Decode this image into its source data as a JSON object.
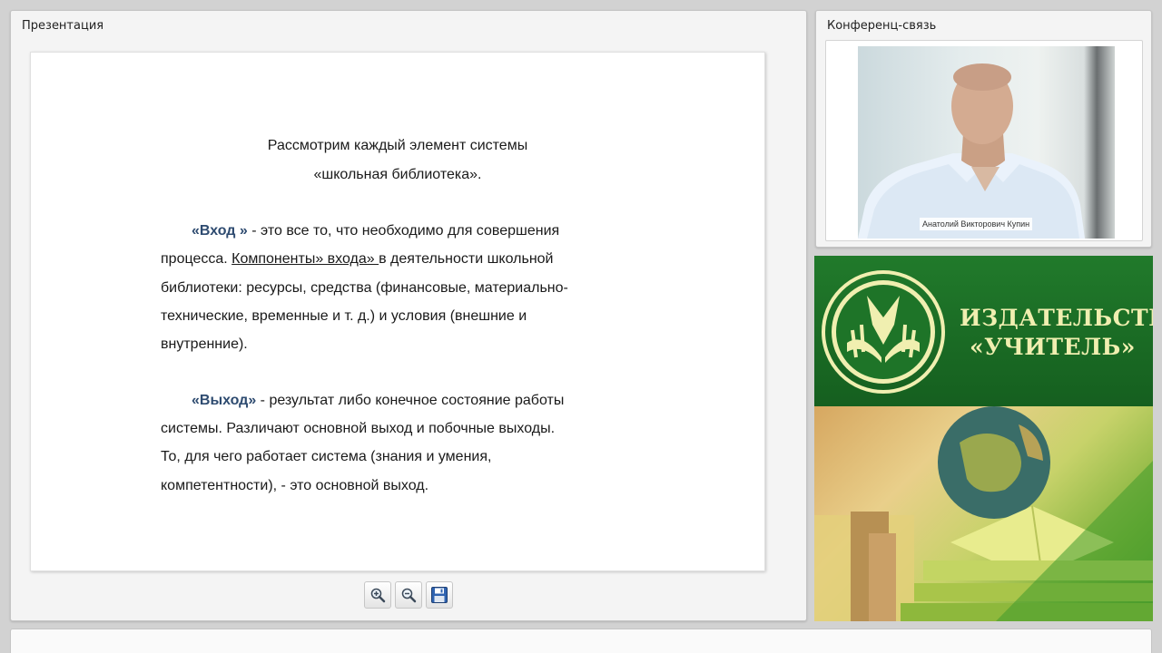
{
  "presentation_panel": {
    "title": "Презентация"
  },
  "slide": {
    "heading_line1": "Рассмотрим каждый элемент системы",
    "heading_line2": "«школьная библиотека».",
    "input_term": "«Вход »",
    "input_text1": " - это все то, что необходимо для совершения",
    "input_text2_a": "процесса.  ",
    "input_text2_link": "Компоненты» входа» ",
    "input_text2_b": "в деятельности школьной",
    "input_text3": "библиотеки:  ресурсы, средства  (финансовые, материально-",
    "input_text4": "технические, временные и т. д.) и условия (внешние и",
    "input_text5": "внутренние).",
    "output_term": "«Выход»",
    "output_text1": " -  результат  либо конечное состояние работы",
    "output_text2": "системы. Различают основной выход и побочные выходы.",
    "output_text3": "То, для чего работает система (знания и умения,",
    "output_text4": "компетентности), - это основной выход."
  },
  "toolbar": {
    "zoom_in_icon": "magnifier-plus",
    "zoom_out_icon": "magnifier-minus",
    "save_icon": "floppy-disk"
  },
  "conference_panel": {
    "title": "Конференц-связь",
    "speaker_name": "Анатолий Викторович Купин"
  },
  "publisher_banner": {
    "line1": "ИЗДАТЕЛЬСТВО",
    "line2": "«УЧИТЕЛЬ»",
    "colors": {
      "green": "#1e7428",
      "logo_cream": "#f0efb0"
    }
  }
}
